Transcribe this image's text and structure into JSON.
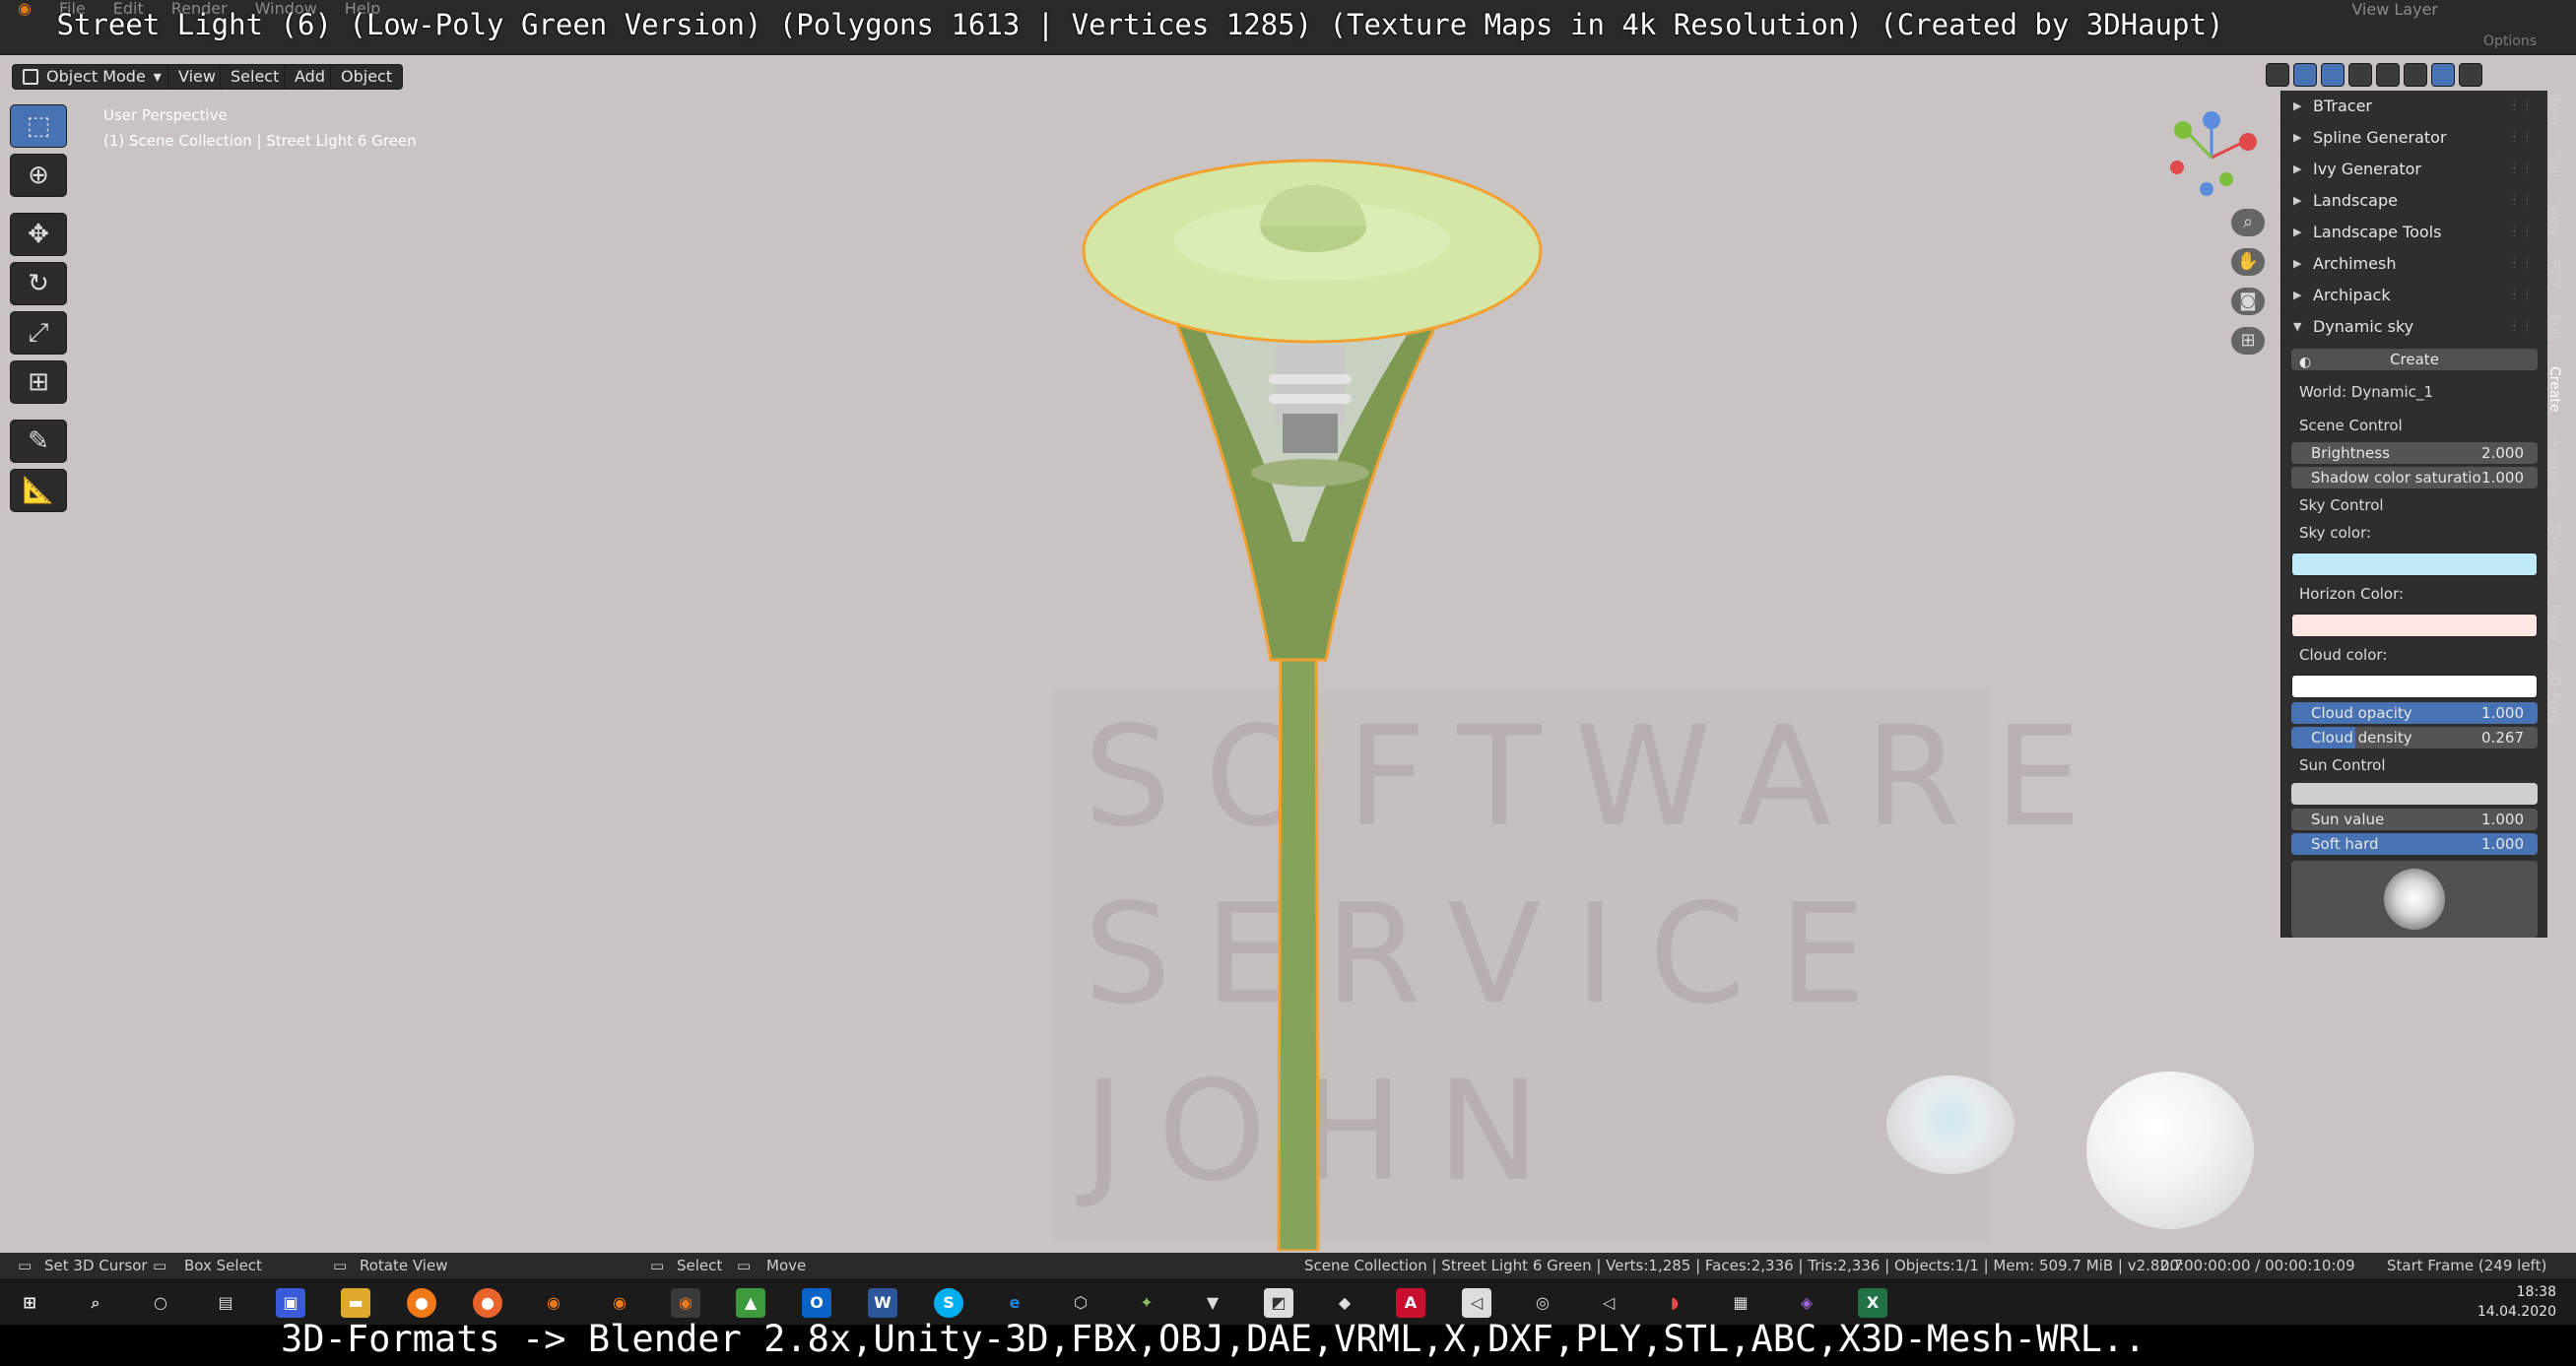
{
  "title_overlay": "Street Light (6) (Low-Poly Green Version) (Polygons 1613 | Vertices 1285) (Texture Maps in 4k Resolution) (Created by 3DHaupt)",
  "top_menu": [
    "File",
    "Edit",
    "Render",
    "Window",
    "Help"
  ],
  "view_layer_label": "View Layer",
  "options_label": "Options",
  "viewport_header": {
    "mode": "Object Mode",
    "menus": [
      "View",
      "Select",
      "Add",
      "Object"
    ]
  },
  "viewport_info": {
    "perspective": "User Perspective",
    "collection": "(1) Scene Collection | Street Light 6 Green"
  },
  "watermark": [
    "SOFTWARE",
    "SERVICE",
    "JOHN"
  ],
  "side_tabs": [
    "Item",
    "Tool",
    "View",
    "PDT",
    "Edit",
    "Create",
    "Animate",
    "3D-Coat",
    "Paper",
    "3D-Print"
  ],
  "panel": {
    "addons": [
      "BTracer",
      "Spline Generator",
      "Ivy Generator",
      "Landscape",
      "Landscape Tools",
      "Archimesh",
      "Archipack",
      "Dynamic sky"
    ],
    "create_label": "Create",
    "world": "World: Dynamic_1",
    "scene_control": "Scene Control",
    "brightness_label": "Brightness",
    "brightness_value": "2.000",
    "shadow_label": "Shadow color saturatio",
    "shadow_value": "1.000",
    "sky_control": "Sky Control",
    "sky_color_label": "Sky color:",
    "horizon_color_label": "Horizon Color:",
    "cloud_color_label": "Cloud color:",
    "cloud_opacity_label": "Cloud opacity",
    "cloud_opacity_value": "1.000",
    "cloud_density_label": "Cloud density",
    "cloud_density_value": "0.267",
    "sun_control": "Sun Control",
    "sun_value_label": "Sun value",
    "sun_value_value": "1.000",
    "soft_hard_label": "Soft hard",
    "soft_hard_value": "1.000",
    "colors": {
      "sky": "#bfeaf7",
      "horizon": "#fde7e5",
      "cloud": "#ffffff"
    }
  },
  "statusbar": {
    "set_cursor": "Set 3D Cursor",
    "box_select": "Box Select",
    "rotate_view": "Rotate View",
    "select": "Select",
    "move": "Move",
    "scene_info": "Scene Collection | Street Light 6 Green | Verts:1,285 | Faces:2,336 | Tris:2,336 | Objects:1/1 | Mem: 509.7 MiB | v2.82.7",
    "timecode": "00:00:00:00 / 00:00:10:09",
    "start_frame": "Start Frame (249 left)"
  },
  "taskbar": {
    "time": "18:38",
    "date": "14.04.2020"
  },
  "bottom_overlay": "3D-Formats -> Blender 2.8x,Unity-3D,FBX,OBJ,DAE,VRML,X,DXF,PLY,STL,ABC,X3D-Mesh-WRL.."
}
